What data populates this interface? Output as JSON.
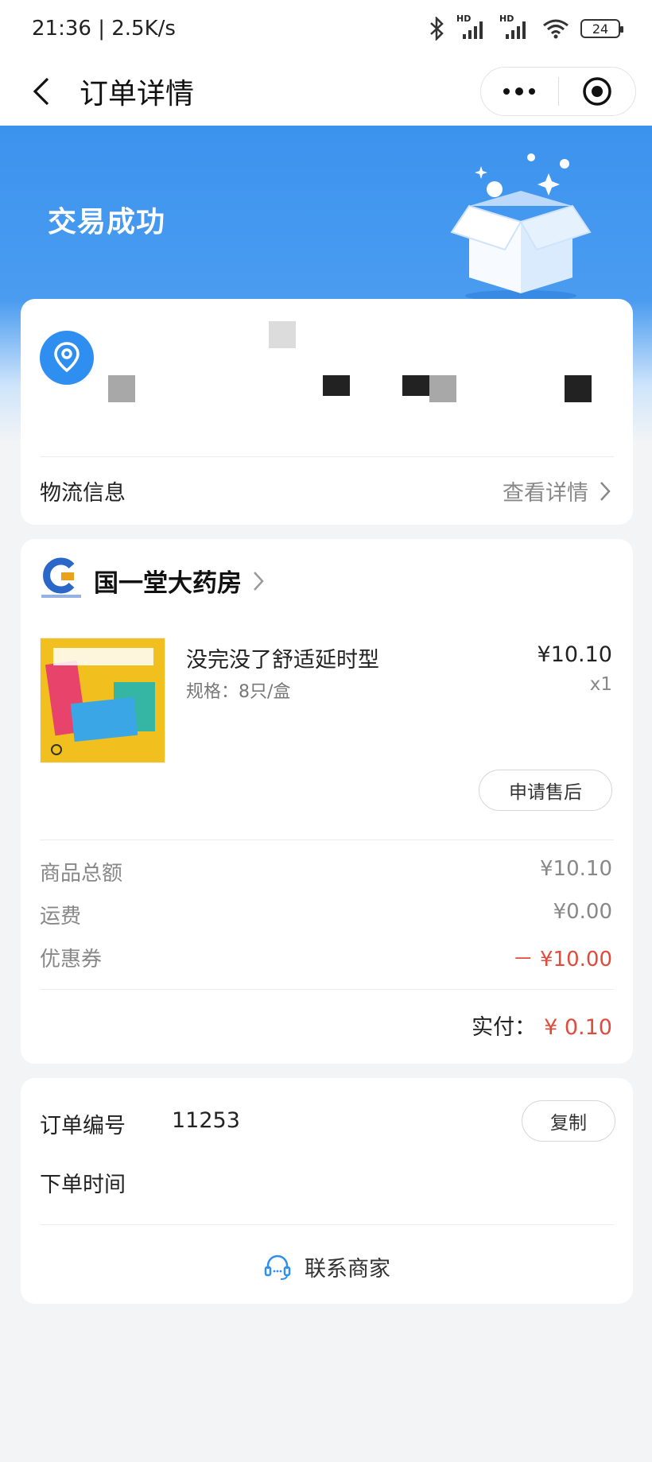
{
  "status_bar": {
    "time_speed": "21:36 | 2.5K/s",
    "battery": "24",
    "hd1": "HD",
    "hd2": "HD"
  },
  "nav": {
    "title": "订单详情"
  },
  "hero": {
    "status": "交易成功"
  },
  "address_card": {
    "logistics_label": "物流信息",
    "logistics_link": "查看详情"
  },
  "order_card": {
    "shop_name": "国一堂大药房",
    "product": {
      "name": "没完没了舒适延时型",
      "spec": "规格：8只/盒",
      "price": "¥10.10",
      "quantity": "x1"
    },
    "after_sale_label": "申请售后",
    "fees": [
      {
        "label": "商品总额",
        "value": "¥10.10"
      },
      {
        "label": "运费",
        "value": "¥0.00"
      },
      {
        "label": "优惠券",
        "value": "－ ¥10.00"
      }
    ],
    "paid_label": "实付：",
    "paid_amount": "¥ 0.10"
  },
  "info_card": {
    "order_no_label": "订单编号",
    "order_no_value": "11253",
    "copy_label": "复制",
    "order_time_label": "下单时间",
    "contact_label": "联系商家"
  },
  "colors": {
    "primary_blue": "#3c93ee",
    "discount_red": "#e04b3c",
    "background": "#f3f4f6"
  }
}
